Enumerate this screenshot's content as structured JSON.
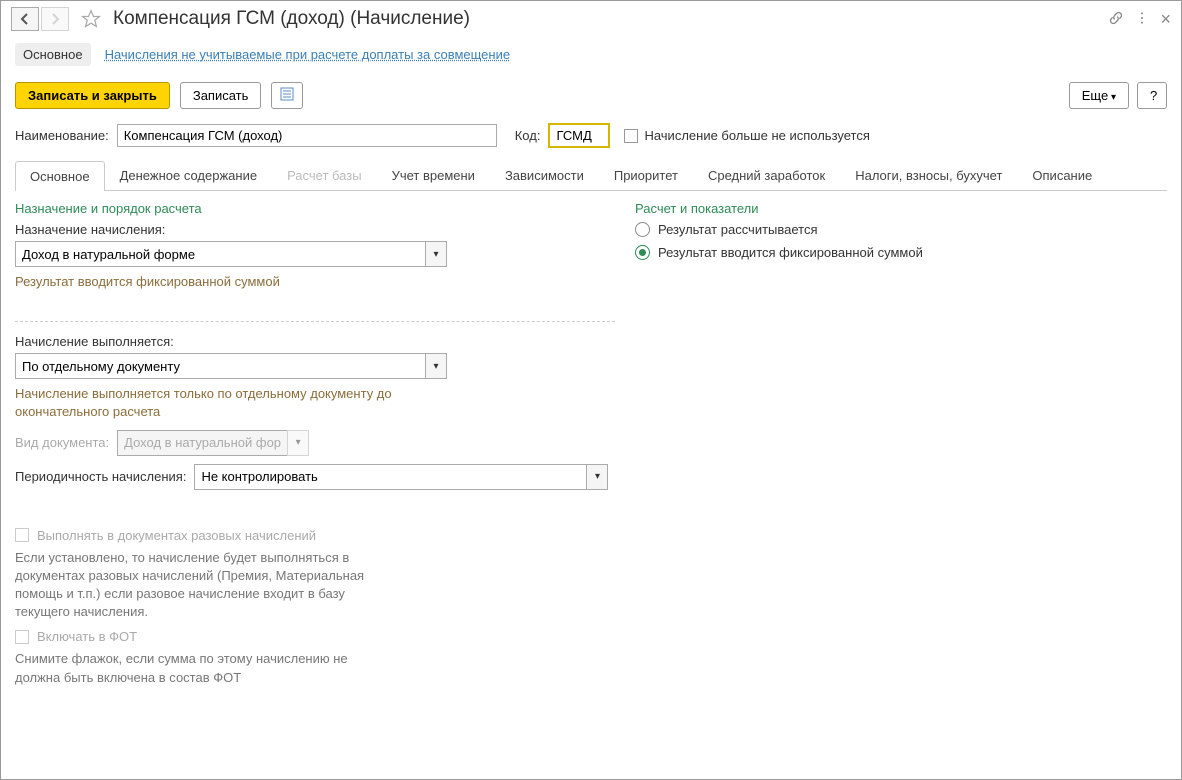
{
  "title": "Компенсация ГСМ (доход) (Начисление)",
  "subnav": {
    "main": "Основное",
    "link": "Начисления не учитываемые при расчете доплаты за совмещение"
  },
  "toolbar": {
    "save_close": "Записать и закрыть",
    "save": "Записать",
    "more": "Еще",
    "help": "?"
  },
  "fields": {
    "name_label": "Наименование:",
    "name_value": "Компенсация ГСМ (доход)",
    "code_label": "Код:",
    "code_value": "ГСМД",
    "notused_label": "Начисление больше не используется"
  },
  "tabs": [
    "Основное",
    "Денежное содержание",
    "Расчет базы",
    "Учет времени",
    "Зависимости",
    "Приоритет",
    "Средний заработок",
    "Налоги, взносы, бухучет",
    "Описание"
  ],
  "left": {
    "section": "Назначение и порядок расчета",
    "purpose_label": "Назначение начисления:",
    "purpose_value": "Доход в натуральной форме",
    "purpose_hint": "Результат вводится фиксированной суммой",
    "exec_label": "Начисление выполняется:",
    "exec_value": "По отдельному документу",
    "exec_hint": "Начисление выполняется только по отдельному документу до окончательного расчета",
    "doc_label": "Вид документа:",
    "doc_value": "Доход в натуральной фор",
    "period_label": "Периодичность начисления:",
    "period_value": "Не контролировать",
    "oneoff_label": "Выполнять в документах разовых начислений",
    "oneoff_hint": "Если установлено, то начисление будет выполняться в документах разовых начислений (Премия, Материальная помощь и т.п.) если разовое начисление входит в базу текущего начисления.",
    "fot_label": "Включать в ФОТ",
    "fot_hint": "Снимите флажок, если сумма по этому начислению не должна быть включена в состав ФОТ"
  },
  "right": {
    "section": "Расчет и показатели",
    "opt1": "Результат рассчитывается",
    "opt2": "Результат вводится фиксированной суммой"
  }
}
